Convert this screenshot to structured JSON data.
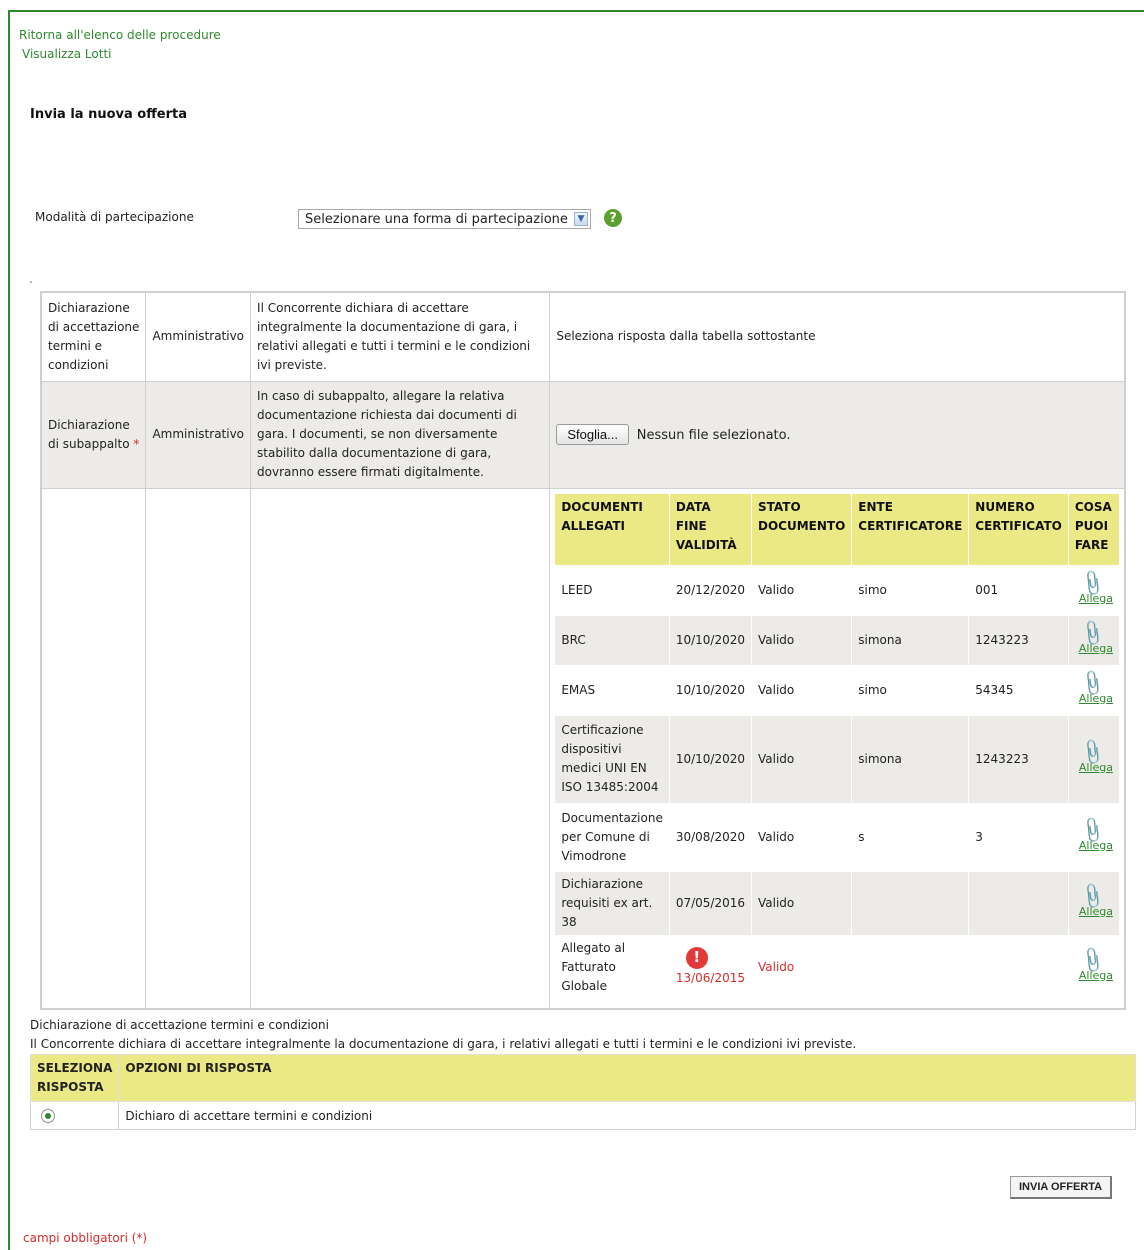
{
  "nav": {
    "back_link": "Ritorna all'elenco delle procedure",
    "lots_link": "Visualizza Lotti"
  },
  "page_title": "Invia la nuova offerta",
  "participation": {
    "label": "Modalità di partecipazione",
    "selected": "Selezionare una forma di partecipazione",
    "help_icon": "question-icon",
    "help_symbol": "?"
  },
  "dot_marker": ".",
  "declarations": [
    {
      "name": "Dichiarazione di accettazione termini e condizioni",
      "type": "Amministrativo",
      "description": "Il Concorrente dichiara di accettare integralmente la documentazione di gara, i relativi allegati e tutti i termini e le condizioni ivi previste.",
      "action": "Seleziona risposta dalla tabella sottostante"
    },
    {
      "name": "Dichiarazione di subappalto",
      "required_mark": "*",
      "type": "Amministrativo",
      "description": "In caso di subappalto, allegare la relativa documentazione richiesta dai documenti di gara. I documenti, se non diversamente stabilito dalla documentazione di gara, dovranno essere firmati digitalmente.",
      "browse_button": "Sfoglia...",
      "no_file": "Nessun file selezionato."
    }
  ],
  "docs_table": {
    "headers": [
      "DOCUMENTI ALLEGATI",
      "DATA FINE VALIDITÀ",
      "STATO DOCUMENTO",
      "ENTE CERTIFICATORE",
      "NUMERO CERTIFICATO",
      "COSA PUOI FARE"
    ],
    "rows": [
      {
        "doc": "LEED",
        "date": "20/12/2020",
        "status": "Valido",
        "ente": "simo",
        "numero": "001",
        "action": "Allega"
      },
      {
        "doc": "BRC",
        "date": "10/10/2020",
        "status": "Valido",
        "ente": "simona",
        "numero": "1243223",
        "action": "Allega"
      },
      {
        "doc": "EMAS",
        "date": "10/10/2020",
        "status": "Valido",
        "ente": "simo",
        "numero": "54345",
        "action": "Allega"
      },
      {
        "doc": "Certificazione dispositivi medici UNI EN ISO 13485:2004",
        "date": "10/10/2020",
        "status": "Valido",
        "ente": "simona",
        "numero": "1243223",
        "action": "Allega"
      },
      {
        "doc": "Documentazione per Comune di Vimodrone",
        "date": "30/08/2020",
        "status": "Valido",
        "ente": "s",
        "numero": "3",
        "action": "Allega"
      },
      {
        "doc": "Dichiarazione requisiti ex art. 38",
        "date": "07/05/2016",
        "status": "Valido",
        "ente": "",
        "numero": "",
        "action": "Allega"
      },
      {
        "doc": "Allegato al Fatturato Globale",
        "date": "13/06/2015",
        "status": "Valido",
        "ente": "",
        "numero": "",
        "action": "Allega",
        "expired": true,
        "warn_symbol": "!"
      }
    ]
  },
  "response_section": {
    "title": "Dichiarazione di accettazione termini e condizioni",
    "description": "Il Concorrente dichiara di accettare integralmente la documentazione di gara, i relativi allegati e tutti i termini e le condizioni ivi previste.",
    "headers": [
      "SELEZIONA RISPOSTA",
      "OPZIONI DI RISPOSTA"
    ],
    "option": "Dichiaro di accettare termini e condizioni"
  },
  "submit_button": "INVIA OFFERTA",
  "required_note": "campi obbligatori (*)",
  "colors": {
    "accent_green": "#2f8a2f",
    "header_yellow": "#ebe985",
    "alt_row": "#ecebe7",
    "error_red": "#d92c2c"
  }
}
